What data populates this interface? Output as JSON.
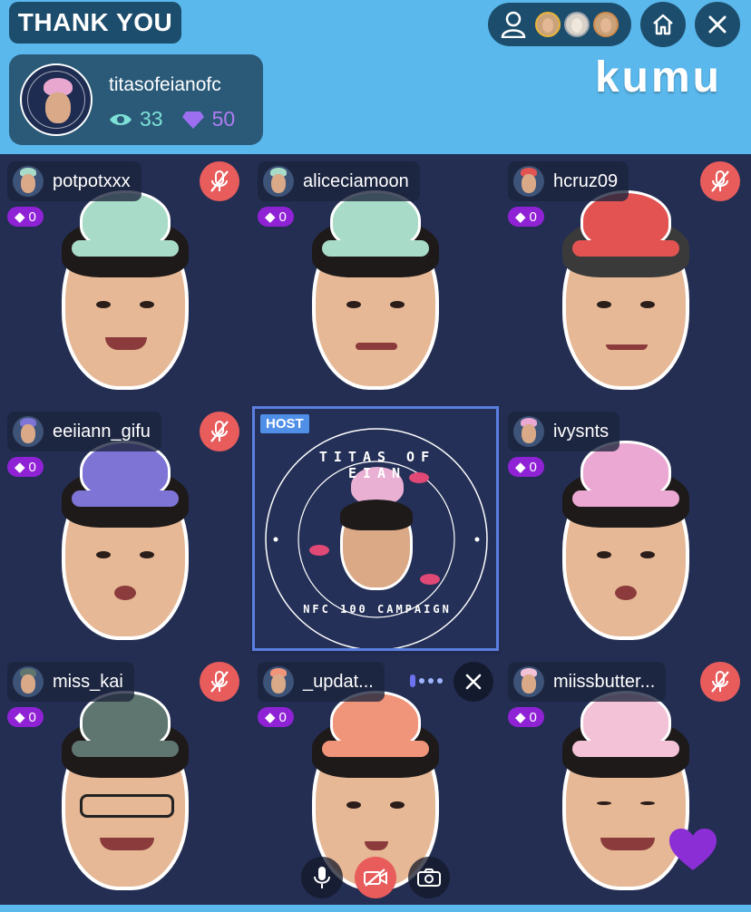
{
  "header": {
    "thank_you": "THANK YOU",
    "brand": "kumu"
  },
  "host": {
    "name": "titasofeianofc",
    "viewers": "33",
    "gems": "50",
    "label": "HOST",
    "campaign_top": "TITAS OF EIAN",
    "campaign_bottom": "NFC 100 CAMPAIGN"
  },
  "guests": [
    {
      "name": "potpotxxx",
      "gems": "0",
      "muted": true,
      "octopus_color": "#a9dcc8"
    },
    {
      "name": "aliceciamoon",
      "gems": "0",
      "muted": false,
      "octopus_color": "#a9dcc8"
    },
    {
      "name": "hcruz09",
      "gems": "0",
      "muted": true,
      "octopus_color": "#e35352"
    },
    {
      "name": "eeiiann_gifu",
      "gems": "0",
      "muted": true,
      "octopus_color": "#7e74d6"
    },
    {
      "name": "ivysnts",
      "gems": "0",
      "muted": false,
      "octopus_color": "#eaa8d2"
    },
    {
      "name": "miss_kai",
      "gems": "0",
      "muted": true,
      "octopus_color": "#5f7670"
    },
    {
      "name": "_updat...",
      "gems": "0",
      "muted": false,
      "octopus_color": "#f0957a"
    },
    {
      "name": "miissbutter...",
      "gems": "0",
      "muted": true,
      "octopus_color": "#f3c2d6"
    }
  ],
  "colors": {
    "accent": "#5ab8ec",
    "dark_panel": "#1c4d6c",
    "mute_red": "#e85c5c",
    "gem_purple": "#9022d6",
    "heart": "#8b2ed6"
  },
  "icons": {
    "profile": "user-icon",
    "home": "home-icon",
    "close": "close-icon",
    "eye": "eye-icon",
    "gem": "gem-icon",
    "mic_off": "mic-off-icon",
    "mic": "mic-icon",
    "camera_off": "camera-off-icon",
    "switch_camera": "switch-camera-icon",
    "heart": "heart-icon"
  }
}
